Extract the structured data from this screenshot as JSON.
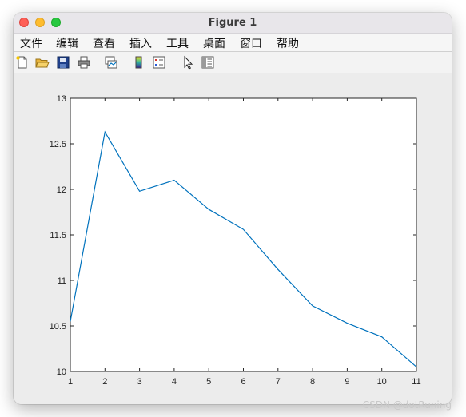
{
  "window": {
    "title": "Figure 1"
  },
  "menu": {
    "items": [
      {
        "label": "文件",
        "name": "menu-file"
      },
      {
        "label": "编辑",
        "name": "menu-edit"
      },
      {
        "label": "查看",
        "name": "menu-view"
      },
      {
        "label": "插入",
        "name": "menu-insert"
      },
      {
        "label": "工具",
        "name": "menu-tools"
      },
      {
        "label": "桌面",
        "name": "menu-desktop"
      },
      {
        "label": "窗口",
        "name": "menu-window"
      },
      {
        "label": "帮助",
        "name": "menu-help"
      }
    ]
  },
  "toolbar": {
    "icons": [
      "new-figure-icon",
      "open-file-icon",
      "save-icon",
      "print-icon",
      "link-plot-icon",
      "insert-colorbar-icon",
      "insert-legend-icon",
      "edit-plot-arrow-icon",
      "property-inspector-icon"
    ]
  },
  "chart_data": {
    "type": "line",
    "x": [
      1,
      2,
      3,
      4,
      5,
      6,
      7,
      8,
      9,
      10,
      11
    ],
    "series": [
      {
        "values": [
          10.55,
          12.63,
          11.98,
          12.1,
          11.78,
          11.56,
          11.12,
          10.72,
          10.53,
          10.38,
          10.05
        ],
        "color": "#0072bd"
      }
    ],
    "xlim": [
      1,
      11
    ],
    "ylim": [
      10,
      13
    ],
    "xticks": [
      "1",
      "2",
      "3",
      "4",
      "5",
      "6",
      "7",
      "8",
      "9",
      "10",
      "11"
    ],
    "yticks": [
      "10",
      "10.5",
      "11",
      "11.5",
      "12",
      "12.5",
      "13"
    ],
    "grid": false,
    "title": "",
    "xlabel": "",
    "ylabel": ""
  },
  "watermark": "CSDN @dotRuning"
}
